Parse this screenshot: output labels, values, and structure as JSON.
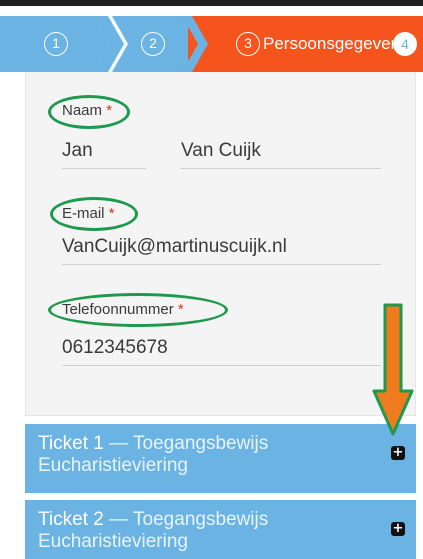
{
  "stepper": {
    "steps": [
      {
        "number": "1"
      },
      {
        "number": "2"
      },
      {
        "number": "3",
        "label": "Persoonsgegevens"
      },
      {
        "number": "4"
      }
    ],
    "colors": {
      "inactive": "#6ab3e3",
      "active": "#f5541d"
    }
  },
  "form": {
    "name": {
      "label": "Naam",
      "required": "*",
      "first": "Jan",
      "last": "Van Cuijk"
    },
    "email": {
      "label": "E-mail",
      "required": "*",
      "value": "VanCuijk@martinuscuijk.nl"
    },
    "phone": {
      "label": "Telefoonnummer",
      "required": "*",
      "value": "0612345678"
    }
  },
  "tickets": [
    {
      "title": "Ticket 1",
      "dash": "—",
      "type": "Toegangsbewijs",
      "line2": "Eucharistieviering",
      "icon": "plus-square-icon"
    },
    {
      "title": "Ticket 2",
      "dash": "—",
      "type": "Toegangsbewijs",
      "line2": "Eucharistieviering",
      "icon": "plus-square-icon"
    }
  ],
  "annotation": {
    "highlight_color": "#1e9a4e",
    "arrow_color": "#f07a1e"
  }
}
